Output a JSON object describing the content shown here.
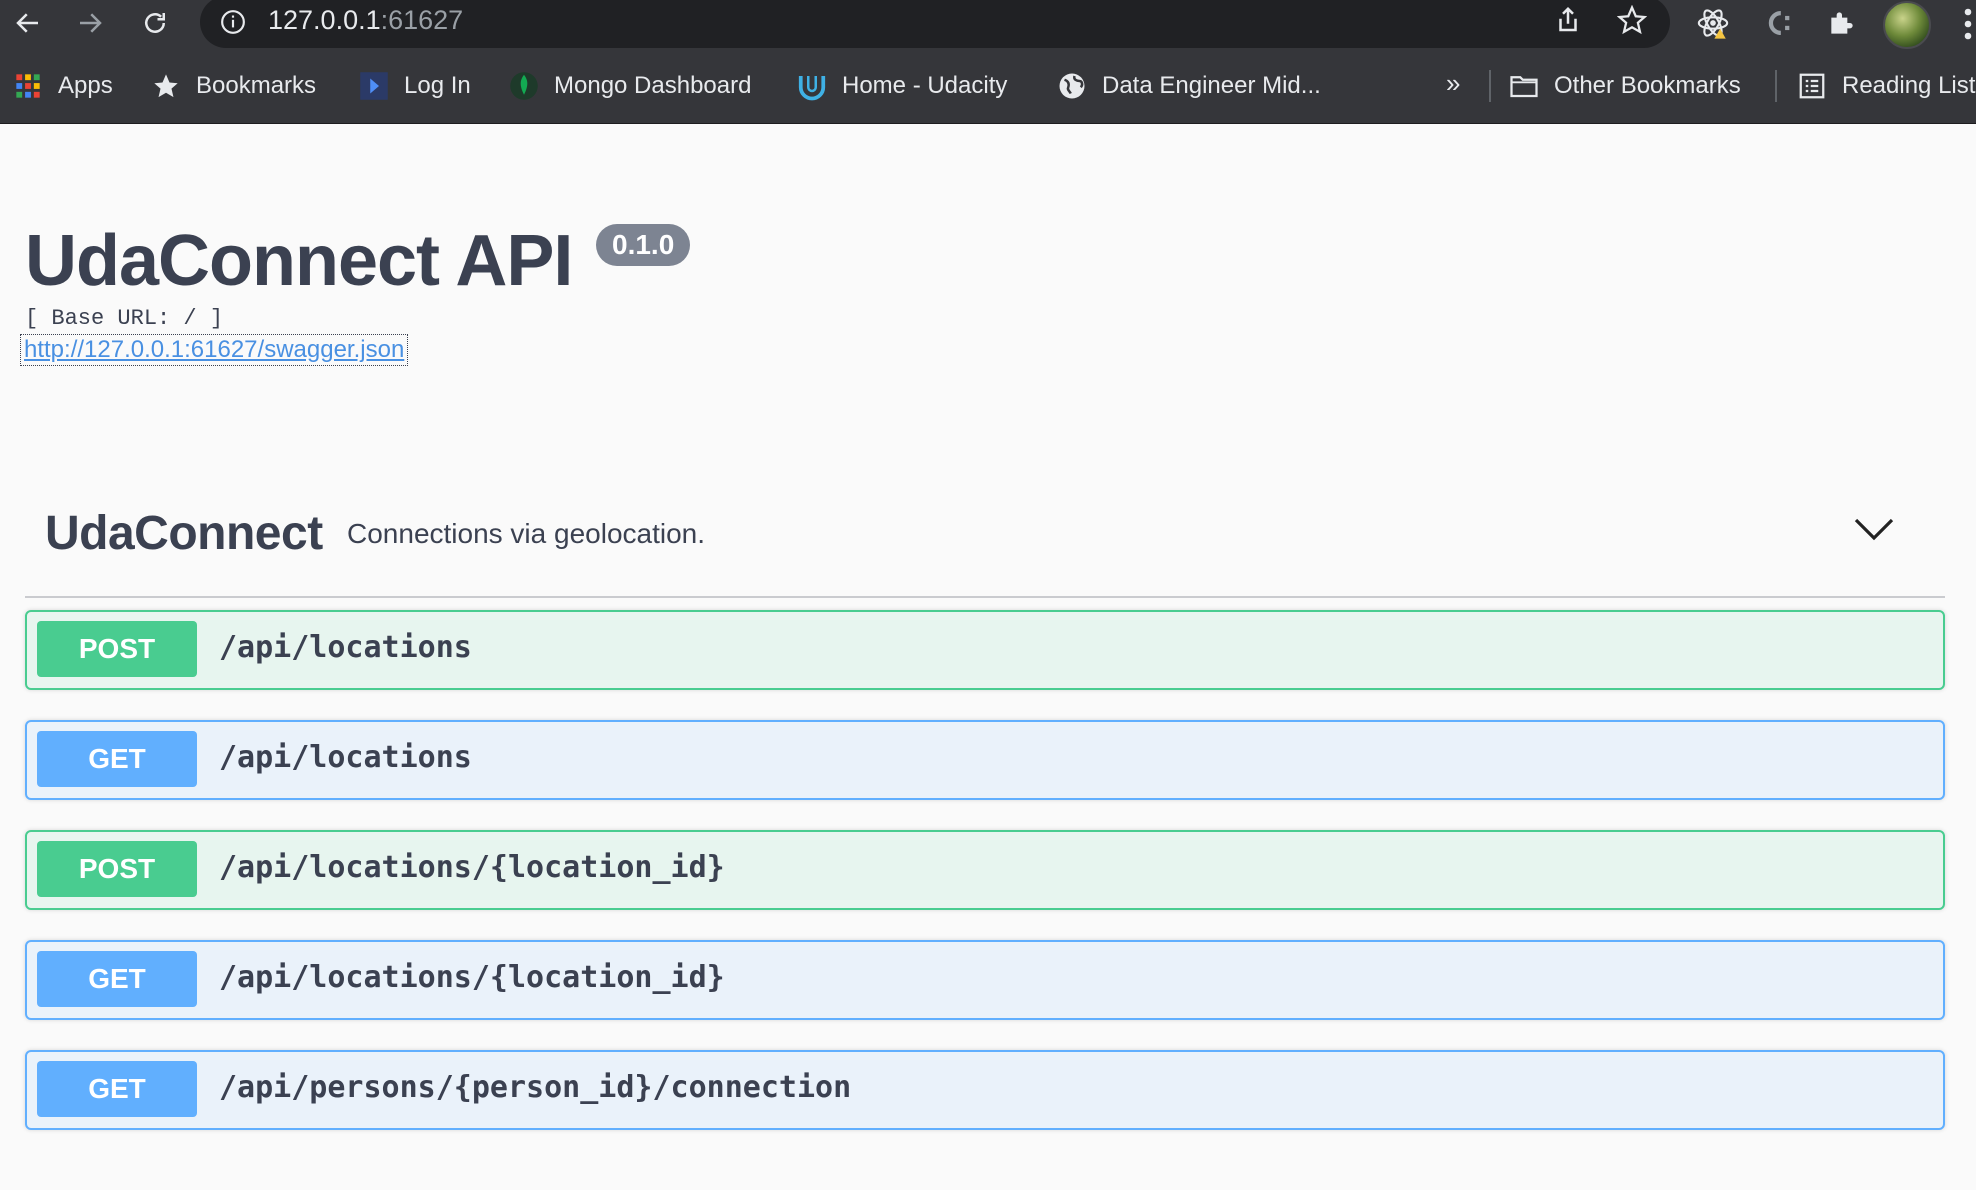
{
  "browser": {
    "url_host": "127.0.0.1",
    "url_port": ":61627",
    "bookmarks": [
      {
        "label": "Apps",
        "icon": "apps-grid-icon"
      },
      {
        "label": "Bookmarks",
        "icon": "star-icon"
      },
      {
        "label": "Log In",
        "icon": "play-bookmark-icon"
      },
      {
        "label": "Mongo Dashboard",
        "icon": "mongodb-leaf-icon"
      },
      {
        "label": "Home - Udacity",
        "icon": "udacity-icon"
      },
      {
        "label": "Data Engineer Mid...",
        "icon": "globe-icon"
      }
    ],
    "more_label": "»",
    "other_bookmarks": "Other Bookmarks",
    "reading_list": "Reading List"
  },
  "api": {
    "title": "UdaConnect API",
    "version": "0.1.0",
    "base_url": "[ Base URL: / ]",
    "spec_link": "http://127.0.0.1:61627/swagger.json"
  },
  "tag": {
    "name": "UdaConnect",
    "description": "Connections via geolocation."
  },
  "operations": [
    {
      "method": "POST",
      "path": "/api/locations"
    },
    {
      "method": "GET",
      "path": "/api/locations"
    },
    {
      "method": "POST",
      "path": "/api/locations/{location_id}"
    },
    {
      "method": "GET",
      "path": "/api/locations/{location_id}"
    },
    {
      "method": "GET",
      "path": "/api/persons/{person_id}/connection"
    }
  ],
  "colors": {
    "post": "#49cc90",
    "get": "#61affe",
    "text": "#3b4151"
  }
}
